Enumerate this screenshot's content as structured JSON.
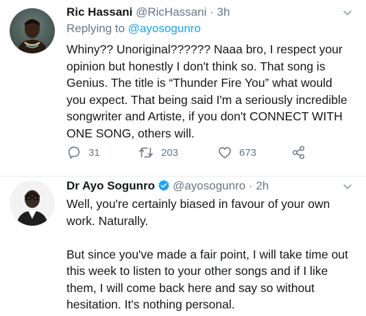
{
  "tweets": [
    {
      "author_name": "Ric Hassani",
      "handle": "@RicHassani",
      "separator": "·",
      "time": "3h",
      "replying_prefix": "Replying to",
      "replying_to": "@ayosogunro",
      "text_paragraphs": [
        "Whiny?? Unoriginal?????? Naaa bro, I respect your opinion but honestly I don't think so. That song is Genius. The title is “Thunder Fire You” what would you expect. That being said I'm a seriously incredible songwriter and Artiste, if you don't CONNECT WITH ONE SONG, others will."
      ],
      "reply_count": "31",
      "retweet_count": "203",
      "like_count": "673"
    },
    {
      "author_name": "Dr Ayo Sogunro",
      "verified": true,
      "handle": "@ayosogunro",
      "separator": "·",
      "time": "2h",
      "text_paragraphs": [
        "Well, you're certainly biased in favour of your own work. Naturally.",
        "But since you've made a fair point, I will take time out this week to listen to your other songs and if I like them, I will come back here and say so without hesitation. It's nothing personal."
      ]
    }
  ],
  "icons": [
    "reply-icon",
    "retweet-icon",
    "like-icon",
    "share-icon",
    "verified-badge-icon",
    "caret-down-icon"
  ],
  "colors": {
    "text": "#14171a",
    "secondary": "#657786",
    "link": "#1da1f2",
    "divider": "#e6ecf0"
  }
}
